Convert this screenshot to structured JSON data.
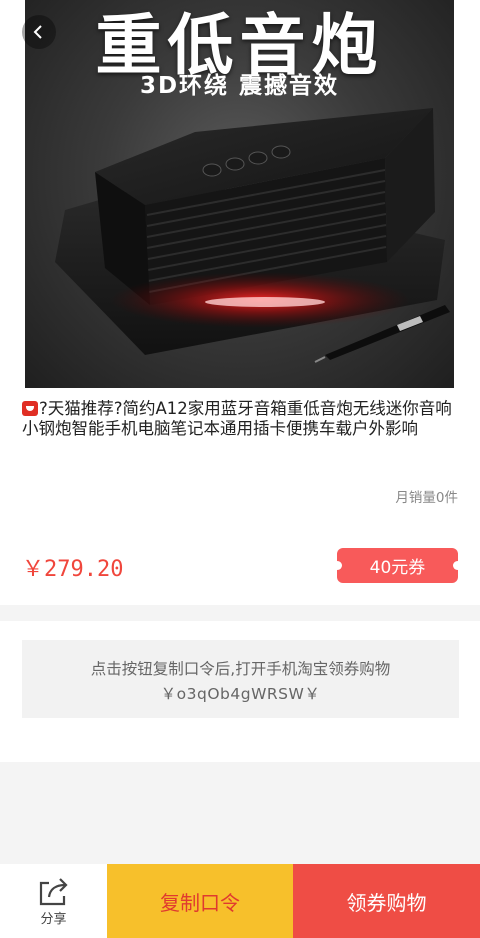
{
  "hero": {
    "headline": "重低音炮",
    "subheadline": "3D环绕  震撼音效"
  },
  "product": {
    "title": "?天猫推荐?简约A12家用蓝牙音箱重低音炮无线迷你音响小钢炮智能手机电脑笔记本通用插卡便携车载户外影响",
    "monthly_sales": "月销量0件",
    "price": "￥279.20",
    "coupon": "40元券"
  },
  "instruction": {
    "text": "点击按钮复制口令后,打开手机淘宝领券购物",
    "token": "￥o3qOb4gWRSW￥"
  },
  "bottom_bar": {
    "share_label": "分享",
    "copy_label": "复制口令",
    "coupon_shop_label": "领券购物"
  },
  "colors": {
    "price_red": "#f0463c",
    "coupon_bg": "#f85a5a",
    "copy_bg": "#f7c02b",
    "shop_bg": "#ef4d45"
  }
}
